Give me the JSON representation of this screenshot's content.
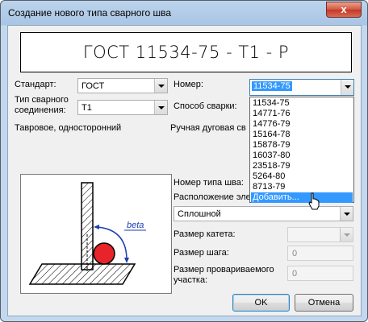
{
  "window": {
    "title": "Создание нового типа сварного шва",
    "close_glyph": "x"
  },
  "preview": {
    "text": "ГОСТ 11534-75 - Т1 - Р"
  },
  "form": {
    "standard_label": "Стандарт:",
    "standard_value": "ГОСТ",
    "number_label": "Номер:",
    "number_value": "11534-75",
    "joint_type_label": "Тип сварного соединения:",
    "joint_type_value": "Т1",
    "welding_method_label": "Способ сварки:",
    "joint_description": "Тавровое, односторонний",
    "welding_method_description": "Ручная дуговая св",
    "seam_type_number_label": "Номер типа шва:",
    "seam_location_label": "Расположение эле",
    "seam_location_value": "Сплошной",
    "leg_size_label": "Размер катета:",
    "pitch_size_label": "Размер шага:",
    "pitch_size_value": "0",
    "welded_section_label": "Размер провариваемого участка:",
    "welded_section_value": "0"
  },
  "dropdown": {
    "items": [
      "11534-75",
      "14771-76",
      "14776-79",
      "15164-78",
      "15878-79",
      "16037-80",
      "23518-79",
      "5264-80",
      "8713-79",
      "Добавить..."
    ],
    "highlighted_index": 9
  },
  "diagram": {
    "angle_label": "beta"
  },
  "buttons": {
    "ok": "OK",
    "cancel": "Отмена"
  },
  "colors": {
    "accent": "#3399ff",
    "weld": "#e8232a",
    "arrow": "#1a3fb0"
  }
}
